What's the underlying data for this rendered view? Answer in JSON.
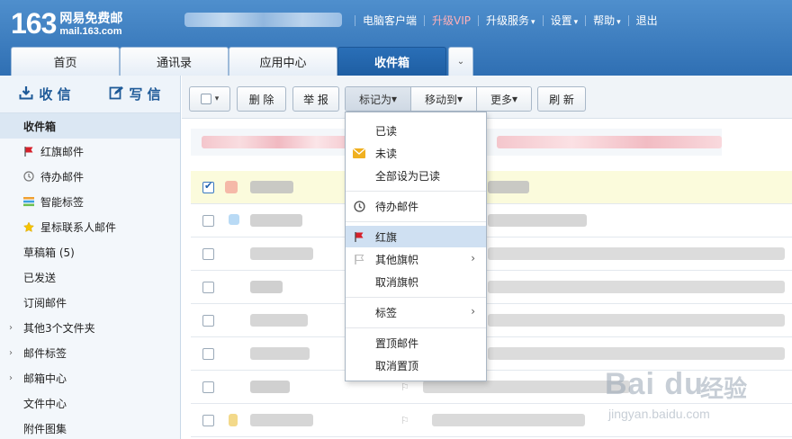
{
  "header": {
    "logo_number": "163",
    "logo_name": "网易免费邮",
    "logo_domain": "mail.163.com",
    "nav": [
      {
        "label": "电脑客户端",
        "has_dropdown": false
      },
      {
        "label": "升级VIP",
        "has_dropdown": false
      },
      {
        "label": "升级服务",
        "has_dropdown": true
      },
      {
        "label": "设置",
        "has_dropdown": true
      },
      {
        "label": "帮助",
        "has_dropdown": true
      },
      {
        "label": "退出",
        "has_dropdown": false
      }
    ],
    "caret": "▾"
  },
  "tabs": [
    {
      "label": "首页",
      "active": false
    },
    {
      "label": "通讯录",
      "active": false
    },
    {
      "label": "应用中心",
      "active": false
    },
    {
      "label": "收件箱",
      "active": true
    }
  ],
  "tab_more_glyph": "⌄",
  "sidebar": {
    "receive_label": "收 信",
    "compose_label": "写 信",
    "folders": [
      {
        "label": "收件箱",
        "icon": "none",
        "active": true
      },
      {
        "label": "红旗邮件",
        "icon": "red-flag-icon"
      },
      {
        "label": "待办邮件",
        "icon": "clock-icon"
      },
      {
        "label": "智能标签",
        "icon": "tag-icon"
      },
      {
        "label": "星标联系人邮件",
        "icon": "star-icon"
      },
      {
        "label": "草稿箱 (5)",
        "icon": "none"
      },
      {
        "label": "已发送",
        "icon": "none"
      },
      {
        "label": "订阅邮件",
        "icon": "none"
      },
      {
        "label": "其他3个文件夹",
        "icon": "chevron-right-icon",
        "group": true
      },
      {
        "label": "邮件标签",
        "icon": "chevron-right-icon",
        "group": true
      },
      {
        "label": "邮箱中心",
        "icon": "chevron-right-icon",
        "group": true
      },
      {
        "label": "文件中心",
        "icon": "none"
      },
      {
        "label": "附件图集",
        "icon": "none"
      }
    ]
  },
  "toolbar": {
    "delete_label": "删 除",
    "report_label": "举 报",
    "mark_as_label": "标记为",
    "move_to_label": "移动到",
    "more_label": "更多",
    "refresh_label": "刷 新",
    "dropdown_glyph": "▾"
  },
  "menu": {
    "items": [
      {
        "label": "已读",
        "icon": "none"
      },
      {
        "label": "未读",
        "icon": "envelope-icon"
      },
      {
        "label": "全部设为已读",
        "icon": "none"
      },
      {
        "label": "待办邮件",
        "icon": "clock-icon"
      },
      {
        "label": "红旗",
        "icon": "red-flag-icon",
        "highlighted": true
      },
      {
        "label": "其他旗帜",
        "icon": "grey-flag-icon",
        "submenu": true
      },
      {
        "label": "取消旗帜",
        "icon": "none"
      },
      {
        "label": "标签",
        "icon": "none",
        "submenu": true
      },
      {
        "label": "置顶邮件",
        "icon": "none"
      },
      {
        "label": "取消置顶",
        "icon": "none"
      }
    ],
    "submenu_glyph": "›"
  },
  "list": {
    "row_count": 8,
    "selected_row": 0
  },
  "colors": {
    "header_blue": "#2f6fb3",
    "active_tab": "#1e5ea3",
    "flag_red": "#d6202a",
    "selected_row": "#fbfbdc",
    "menu_highlight": "#cfe0f2"
  },
  "watermark": {
    "logo": "Bai du",
    "cn": "经验",
    "url": "jingyan.baidu.com"
  }
}
